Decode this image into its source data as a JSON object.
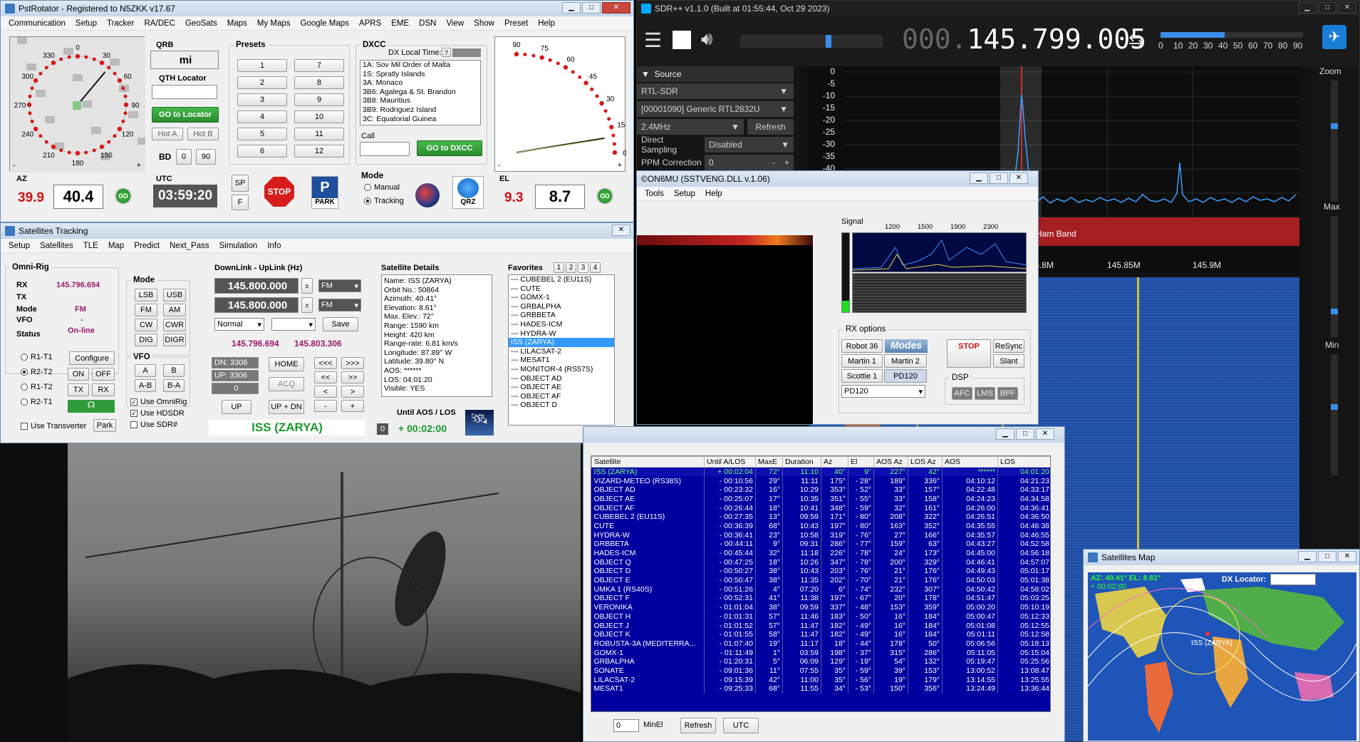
{
  "pst": {
    "title": "PstRotator - Registered to N5ZKK   v17.67",
    "menu": [
      "Communication",
      "Setup",
      "Tracker",
      "RA/DEC",
      "GeoSats",
      "Maps",
      "My Maps",
      "Google Maps",
      "APRS",
      "EME",
      "DSN",
      "View",
      "Show",
      "Preset",
      "Help"
    ],
    "compass_ticks": [
      "0",
      "30",
      "60",
      "90",
      "120",
      "150",
      "180",
      "210",
      "240",
      "270",
      "300",
      "330"
    ],
    "az_label": "AZ",
    "az_current": "39.9",
    "az_target": "40.4",
    "go": "GO",
    "qrb_label": "QRB",
    "qrb_unit": "mi",
    "qth_label": "QTH Locator",
    "go_locator": "GO to Locator",
    "hot_a": "Hot A",
    "hot_b": "Hot B",
    "bd": "BD",
    "bd_0": "0",
    "bd_90": "90",
    "utc_label": "UTC",
    "utc": "03:59:20",
    "sp": "SP",
    "f": "F",
    "stop": "STOP",
    "park": "PARK",
    "presets_label": "Presets",
    "presets": [
      "1",
      "7",
      "2",
      "8",
      "3",
      "9",
      "4",
      "10",
      "5",
      "11",
      "6",
      "12"
    ],
    "dxcc_label": "DXCC",
    "dx_local": "DX Local Time:",
    "dx_q": "?",
    "dxcc_list": [
      "1A:  Sov Mil Order of Malta",
      "1S:  Spratly Islands",
      "3A:  Monaco",
      "3B6:  Agalega & St. Brandon",
      "3B8:  Mauritius",
      "3B9:  Rodriguez Island",
      "3C:  Equatorial Guinea"
    ],
    "call_label": "Call",
    "go_dxcc": "GO to DXCC",
    "mode_label": "Mode",
    "manual": "Manual",
    "tracking": "Tracking",
    "qrz": "QRZ",
    "el_ticks": [
      "90",
      "75",
      "60",
      "45",
      "30",
      "15",
      "0"
    ],
    "el_label": "EL",
    "el_current": "9.3",
    "el_target": "8.7",
    "minus": "-",
    "plus": "+"
  },
  "sat": {
    "title": "Satellites Tracking",
    "menu": [
      "Setup",
      "Satellites",
      "TLE",
      "Map",
      "Predict",
      "Next_Pass",
      "Simulation",
      "Info"
    ],
    "omni_label": "Omni-Rig",
    "rx_l": "RX",
    "rx": "145.796.694",
    "tx_l": "TX",
    "mode_l": "Mode",
    "mode": "FM",
    "vfo_l": "VFO",
    "vfo": "-",
    "status_l": "Status",
    "status": "On-line",
    "rigs": [
      "R1-T1",
      "R2-T2",
      "R1-T2",
      "R2-T1"
    ],
    "configure": "Configure",
    "on": "ON",
    "off": "OFF",
    "tx": "TX",
    "rx_btn": "RX",
    "use_transverter": "Use Transverter",
    "park": "Park",
    "mode_grp": "Mode",
    "modes": [
      "LSB",
      "USB",
      "FM",
      "AM",
      "CW",
      "CWR",
      "DIG",
      "DIGR"
    ],
    "vfo_grp": "VFO",
    "vfo_a": "A",
    "vfo_b": "B",
    "ab": "A-B",
    "ba": "B-A",
    "use_omnirig": "Use OmniRig",
    "use_hdsdr": "Use HDSDR",
    "use_sdr": "Use SDR#",
    "dl_label": "DownLink - UpLink (Hz)",
    "dl": "145.800.000",
    "ul": "145.800.000",
    "fm": "FM",
    "normal": "Normal",
    "save": "Save",
    "rx_freq": "145.796.694",
    "tx_freq": "145.803.306",
    "dn": "DN: 3306",
    "up": "UP: 3306",
    "zero": "0",
    "home": "HOME",
    "acq": "ACQ",
    "up_btn": "UP",
    "updn": "UP + DN",
    "arrows": [
      "<<<",
      ">>>",
      "<<",
      ">>",
      "<",
      ">",
      "-",
      "+"
    ],
    "sat_name": "ISS (ZARYA)",
    "details_label": "Satellite Details",
    "details": [
      "Name: ISS (ZARYA)",
      "Orbit No.: 50864",
      "Azimuth: 40.41°",
      "Elevation: 8.61°",
      "Max. Elev.:  72°",
      "Range:  1590 km",
      "Height:  420 km",
      "Range-rate: 6.81 km/s",
      "Longitude: 87.89° W",
      "Latitude: 39.80° N",
      "AOS: ******",
      "LOS: 04:01:20",
      "Visible: YES"
    ],
    "until_label": "Until AOS / LOS",
    "until_n": "0",
    "until": "+ 00:02:00",
    "fav_label": "Favorites",
    "fav_tabs": [
      "1",
      "2",
      "3",
      "4"
    ],
    "favs": [
      "--- CUBEBEL 2 (EU11S)",
      "--- CUTE",
      "--- GOMX-1",
      "--- GRBALPHA",
      "--- GRBBETA",
      "--- HADES-ICM",
      "--- HYDRA-W",
      "ISS (ZARYA)",
      "--- LILACSAT-2",
      "--- MESAT1",
      "--- MONITOR-4 (RS57S)",
      "--- OBJECT AD",
      "--- OBJECT AE",
      "--- OBJECT AF",
      "--- OBJECT D"
    ]
  },
  "sdr": {
    "title": "SDR++ v1.1.0 (Built at 01:55:44, Oct 29 2023)",
    "freq_dim": "000.",
    "freq": "145.799.005",
    "snr_ticks": [
      "0",
      "10",
      "20",
      "30",
      "40",
      "50",
      "60",
      "70",
      "80",
      "90"
    ],
    "source": "Source",
    "device": "RTL-SDR",
    "dongle": "[00001090] Generic RTL2832U",
    "rate": "2.4MHz",
    "refresh": "Refresh",
    "ds_l": "Direct Sampling",
    "ds": "Disabled",
    "ppm_l": "PPM Correction",
    "ppm": "0",
    "db_ticks": [
      "0",
      "-5",
      "-10",
      "-15",
      "-20",
      "-25",
      "-30",
      "-35",
      "-40"
    ],
    "band": "2m Ham Band",
    "freq_ticks": [
      "145.8M",
      "145.85M",
      "145.9M"
    ],
    "zoom": "Zoom",
    "max": "Max",
    "min": "Min"
  },
  "sstv": {
    "title": "©ON6MU (SSTVENG.DLL v.1.06)",
    "menu": [
      "Tools",
      "Setup",
      "Help"
    ],
    "signal": "Signal",
    "sig_ticks": [
      "1200",
      "1500",
      "1900",
      "2300"
    ],
    "rx_options": "RX options",
    "robot": "Robot 36",
    "modes_logo": "Modes",
    "stop": "STOP",
    "resync": "ReSync",
    "martin1": "Martin 1",
    "martin2": "Martin 2",
    "slant": "Slant",
    "scottie": "Scottie 1",
    "pd120": "PD120",
    "dsp": "DSP",
    "afc": "AFC",
    "lms": "LMS",
    "bpf": "BPF",
    "mode_sel": "PD120"
  },
  "table": {
    "headers": [
      "Satellite",
      "Until A/LOS",
      "MaxE",
      "Duration",
      "Az",
      "El",
      "AOS Az",
      "LOS Az",
      "AOS",
      "LOS"
    ],
    "rows": [
      [
        "ISS (ZARYA)",
        "+ 00:02:04",
        "72°",
        "11:10",
        "40°",
        "9°",
        "227°",
        "42°",
        "******",
        "04:01:20"
      ],
      [
        "VIZARD-METEO (RS38S)",
        "- 00:10:56",
        "29°",
        "11:11",
        "175°",
        "- 28°",
        "189°",
        "336°",
        "04:10:12",
        "04:21:23"
      ],
      [
        "OBJECT AD",
        "- 00:23:32",
        "16°",
        "10:29",
        "353°",
        "- 52°",
        "33°",
        "157°",
        "04:22:48",
        "04:33:17"
      ],
      [
        "OBJECT AE",
        "- 00:25:07",
        "17°",
        "10:35",
        "351°",
        "- 55°",
        "33°",
        "158°",
        "04:24:23",
        "04:34:58"
      ],
      [
        "OBJECT AF",
        "- 00:26:44",
        "18°",
        "10:41",
        "348°",
        "- 59°",
        "32°",
        "161°",
        "04:26:00",
        "04:36:41"
      ],
      [
        "CUBEBEL 2 (EU11S)",
        "- 00:27:35",
        "13°",
        "09:59",
        "171°",
        "- 80°",
        "208°",
        "322°",
        "04:26:51",
        "04:36:50"
      ],
      [
        "CUTE",
        "- 00:36:39",
        "68°",
        "10:43",
        "197°",
        "- 80°",
        "163°",
        "352°",
        "04:35:55",
        "04:46:38"
      ],
      [
        "HYDRA-W",
        "- 00:36:41",
        "23°",
        "10:58",
        "319°",
        "- 76°",
        "27°",
        "166°",
        "04:35:57",
        "04:46:55"
      ],
      [
        "GRBBETA",
        "- 00:44:11",
        "9°",
        "09:31",
        "286°",
        "- 77°",
        "159°",
        "63°",
        "04:43:27",
        "04:52:58"
      ],
      [
        "HADES-ICM",
        "- 00:45:44",
        "32°",
        "11:18",
        "226°",
        "- 78°",
        "24°",
        "173°",
        "04:45:00",
        "04:56:18"
      ],
      [
        "OBJECT Q",
        "- 00:47:25",
        "18°",
        "10:26",
        "347°",
        "- 78°",
        "200°",
        "329°",
        "04:46:41",
        "04:57:07"
      ],
      [
        "OBJECT D",
        "- 00:50:27",
        "38°",
        "10:43",
        "203°",
        "- 76°",
        "21°",
        "176°",
        "04:49:43",
        "05:01:17"
      ],
      [
        "OBJECT E",
        "- 00:50:47",
        "38°",
        "11:35",
        "202°",
        "- 70°",
        "21°",
        "176°",
        "04:50:03",
        "05:01:38"
      ],
      [
        "UMKA 1 (RS40S)",
        "- 00:51:26",
        "4°",
        "07:20",
        "6°",
        "- 74°",
        "232°",
        "307°",
        "04:50:42",
        "04:58:02"
      ],
      [
        "OBJECT F",
        "- 00:52:31",
        "41°",
        "11:38",
        "197°",
        "- 67°",
        "20°",
        "178°",
        "04:51:47",
        "05:03:25"
      ],
      [
        "VERONIKA",
        "- 01:01:04",
        "38°",
        "09:59",
        "337°",
        "- 48°",
        "153°",
        "359°",
        "05:00:20",
        "05:10:19"
      ],
      [
        "OBJECT H",
        "- 01:01:31",
        "57°",
        "11:46",
        "183°",
        "- 50°",
        "16°",
        "184°",
        "05:00:47",
        "05:12:33"
      ],
      [
        "OBJECT J",
        "- 01:01:52",
        "57°",
        "11:47",
        "182°",
        "- 49°",
        "16°",
        "184°",
        "05:01:08",
        "05:12:55"
      ],
      [
        "OBJECT K",
        "- 01:01:55",
        "58°",
        "11:47",
        "182°",
        "- 49°",
        "16°",
        "184°",
        "05:01:11",
        "05:12:58"
      ],
      [
        "ROBUSTA-3A (MEDITERRA...",
        "- 01:07:40",
        "19°",
        "11:17",
        "18°",
        "- 44°",
        "178°",
        "50°",
        "05:06:56",
        "05:18:13"
      ],
      [
        "GOMX-1",
        "- 01:11:49",
        "1°",
        "03:59",
        "198°",
        "- 37°",
        "315°",
        "286°",
        "05:11:05",
        "05:15:04"
      ],
      [
        "GRBALPHA",
        "- 01:20:31",
        "5°",
        "06:09",
        "129°",
        "- 19°",
        "54°",
        "132°",
        "05:19:47",
        "05:25:56"
      ],
      [
        "SONATE",
        "- 09:01:36",
        "11°",
        "07:55",
        "35°",
        "- 59°",
        "39°",
        "153°",
        "13:00:52",
        "13:08:47"
      ],
      [
        "LILACSAT-2",
        "- 09:15:39",
        "42°",
        "11:00",
        "35°",
        "- 56°",
        "19°",
        "179°",
        "13:14:55",
        "13:25:55"
      ],
      [
        "MESAT1",
        "- 09:25:33",
        "68°",
        "11:55",
        "34°",
        "- 53°",
        "150°",
        "356°",
        "13:24:49",
        "13:36:44"
      ]
    ],
    "minel": "MinEl",
    "minel_val": "0",
    "refresh": "Refresh",
    "utc": "UTC"
  },
  "map": {
    "title": "Satellites Map",
    "readout": "AZ: 40.41°  EL: 8.61°",
    "timer": "+ 00:02:00",
    "dx_loc": "DX Locator:",
    "iss": "ISS (ZARYA)"
  }
}
